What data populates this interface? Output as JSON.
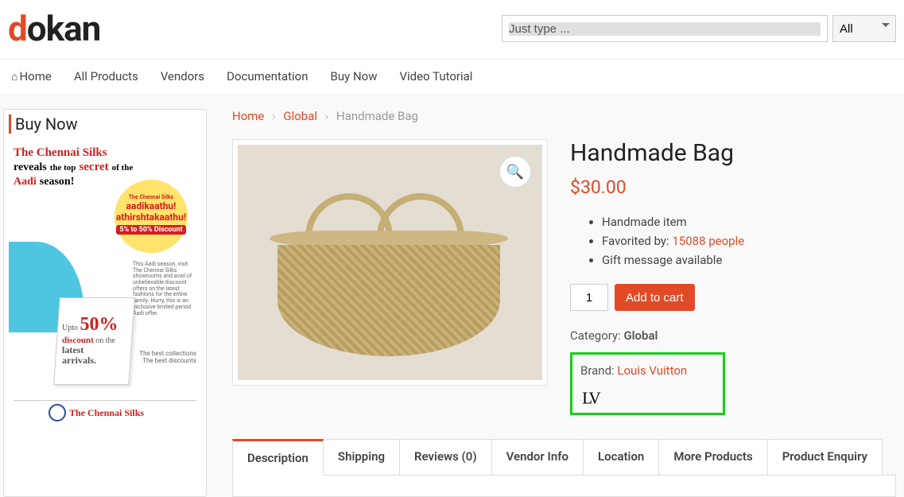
{
  "header": {
    "logo_d": "d",
    "logo_rest": "okan",
    "search_placeholder": "Just type ...",
    "category_filter": "All"
  },
  "nav": {
    "items": [
      {
        "label": "Home",
        "icon": true
      },
      {
        "label": "All Products"
      },
      {
        "label": "Vendors"
      },
      {
        "label": "Documentation"
      },
      {
        "label": "Buy Now"
      },
      {
        "label": "Video Tutorial"
      }
    ]
  },
  "sidebar": {
    "title": "Buy Now",
    "ad": {
      "line1_red": "The Chennai Silks",
      "line2a": "reveals",
      "line2b": "the top",
      "line2c": "secret",
      "line2d": "of the",
      "line3a": "Aadi",
      "line3b": "season!",
      "badge_top": "The Chennai Silks",
      "badge_l1": "aadikaathu!",
      "badge_l2": "athirshtakaathu!",
      "badge_disc": "5% to 50% Discount",
      "small": "This Aadi season, visit The Chennai Silks showrooms and avail of unbelievable discount offers on the latest fashions for the entire family. Hurry, this is an exclusive limited period Aadi offer.",
      "bag_upto": "Upto",
      "bag_pct": "50%",
      "bag_disc": "discount",
      "bag_on": "on the",
      "bag_latest": "latest",
      "bag_arr": "arrivals.",
      "rt1": "The best collections",
      "rt2": "The best discounts",
      "footer_name": "The Chennai Silks"
    }
  },
  "breadcrumb": {
    "home": "Home",
    "cat": "Global",
    "current": "Handmade Bag"
  },
  "product": {
    "title": "Handmade Bag",
    "currency": "$",
    "price": "30.00",
    "features": {
      "f1": "Handmade item",
      "f2_pre": "Favorited by: ",
      "f2_link": "15088 people",
      "f3": "Gift message available"
    },
    "qty": "1",
    "add_to_cart": "Add to cart",
    "category_label": "Category: ",
    "category_value": "Global",
    "brand_label": "Brand: ",
    "brand_value": "Louis Vuitton"
  },
  "tabs": [
    {
      "label": "Description",
      "active": true
    },
    {
      "label": "Shipping"
    },
    {
      "label": "Reviews (0)"
    },
    {
      "label": "Vendor Info"
    },
    {
      "label": "Location"
    },
    {
      "label": "More Products"
    },
    {
      "label": "Product Enquiry"
    }
  ]
}
